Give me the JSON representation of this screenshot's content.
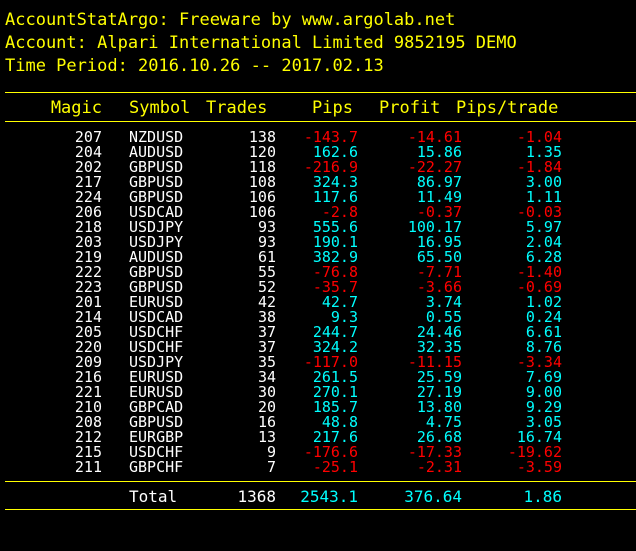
{
  "header": {
    "title": "AccountStatArgo: Freeware by www.argolab.net",
    "account": "Account: Alpari International Limited 9852195 DEMO",
    "period": "Time Period: 2016.10.26 -- 2017.02.13"
  },
  "columns": [
    "Magic",
    "Symbol",
    "Trades",
    "Pips",
    "Profit",
    "Pips/trade"
  ],
  "colors": {
    "header": "#ffff00",
    "text": "#ffffff",
    "positive": "#00ffff",
    "negative": "#ff0000"
  },
  "rows": [
    {
      "magic": "207",
      "symbol": "NZDUSD",
      "trades": "138",
      "pips": "-143.7",
      "profit": "-14.61",
      "ppt": "-1.04"
    },
    {
      "magic": "204",
      "symbol": "AUDUSD",
      "trades": "120",
      "pips": "162.6",
      "profit": "15.86",
      "ppt": "1.35"
    },
    {
      "magic": "202",
      "symbol": "GBPUSD",
      "trades": "118",
      "pips": "-216.9",
      "profit": "-22.27",
      "ppt": "-1.84"
    },
    {
      "magic": "217",
      "symbol": "GBPUSD",
      "trades": "108",
      "pips": "324.3",
      "profit": "86.97",
      "ppt": "3.00"
    },
    {
      "magic": "224",
      "symbol": "GBPUSD",
      "trades": "106",
      "pips": "117.6",
      "profit": "11.49",
      "ppt": "1.11"
    },
    {
      "magic": "206",
      "symbol": "USDCAD",
      "trades": "106",
      "pips": "-2.8",
      "profit": "-0.37",
      "ppt": "-0.03"
    },
    {
      "magic": "218",
      "symbol": "USDJPY",
      "trades": "93",
      "pips": "555.6",
      "profit": "100.17",
      "ppt": "5.97"
    },
    {
      "magic": "203",
      "symbol": "USDJPY",
      "trades": "93",
      "pips": "190.1",
      "profit": "16.95",
      "ppt": "2.04"
    },
    {
      "magic": "219",
      "symbol": "AUDUSD",
      "trades": "61",
      "pips": "382.9",
      "profit": "65.50",
      "ppt": "6.28"
    },
    {
      "magic": "222",
      "symbol": "GBPUSD",
      "trades": "55",
      "pips": "-76.8",
      "profit": "-7.71",
      "ppt": "-1.40"
    },
    {
      "magic": "223",
      "symbol": "GBPUSD",
      "trades": "52",
      "pips": "-35.7",
      "profit": "-3.66",
      "ppt": "-0.69"
    },
    {
      "magic": "201",
      "symbol": "EURUSD",
      "trades": "42",
      "pips": "42.7",
      "profit": "3.74",
      "ppt": "1.02"
    },
    {
      "magic": "214",
      "symbol": "USDCAD",
      "trades": "38",
      "pips": "9.3",
      "profit": "0.55",
      "ppt": "0.24"
    },
    {
      "magic": "205",
      "symbol": "USDCHF",
      "trades": "37",
      "pips": "244.7",
      "profit": "24.46",
      "ppt": "6.61"
    },
    {
      "magic": "220",
      "symbol": "USDCHF",
      "trades": "37",
      "pips": "324.2",
      "profit": "32.35",
      "ppt": "8.76"
    },
    {
      "magic": "209",
      "symbol": "USDJPY",
      "trades": "35",
      "pips": "-117.0",
      "profit": "-11.15",
      "ppt": "-3.34"
    },
    {
      "magic": "216",
      "symbol": "EURUSD",
      "trades": "34",
      "pips": "261.5",
      "profit": "25.59",
      "ppt": "7.69"
    },
    {
      "magic": "221",
      "symbol": "EURUSD",
      "trades": "30",
      "pips": "270.1",
      "profit": "27.19",
      "ppt": "9.00"
    },
    {
      "magic": "210",
      "symbol": "GBPCAD",
      "trades": "20",
      "pips": "185.7",
      "profit": "13.80",
      "ppt": "9.29"
    },
    {
      "magic": "208",
      "symbol": "GBPUSD",
      "trades": "16",
      "pips": "48.8",
      "profit": "4.75",
      "ppt": "3.05"
    },
    {
      "magic": "212",
      "symbol": "EURGBP",
      "trades": "13",
      "pips": "217.6",
      "profit": "26.68",
      "ppt": "16.74"
    },
    {
      "magic": "215",
      "symbol": "USDCHF",
      "trades": "9",
      "pips": "-176.6",
      "profit": "-17.33",
      "ppt": "-19.62"
    },
    {
      "magic": "211",
      "symbol": "GBPCHF",
      "trades": "7",
      "pips": "-25.1",
      "profit": "-2.31",
      "ppt": "-3.59"
    }
  ],
  "total": {
    "label": "Total",
    "trades": "1368",
    "pips": "2543.1",
    "profit": "376.64",
    "ppt": "1.86"
  }
}
